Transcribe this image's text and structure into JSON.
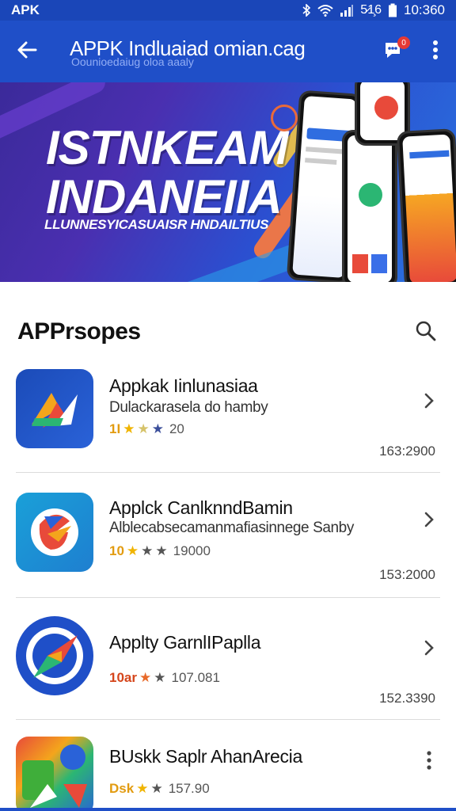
{
  "status_bar": {
    "carrier": "APK",
    "signal_text": "5̷1̧6",
    "time": "10:360"
  },
  "app_bar": {
    "title": "APPK Indluaiad omian.cag",
    "subtitle": "Oounioedaiug oloa aaaly",
    "back_icon": "arrow-left-icon",
    "chat_icon": "chat-icon",
    "chat_badge": "0",
    "more_icon": "more-vert-icon"
  },
  "banner": {
    "headline_line1": "ISTNKEAM",
    "headline_line2": "INDANEIIA",
    "tagline": "LLUNNESYICASUAISR HNDAILTIUS"
  },
  "section": {
    "title": "APPrsopes",
    "search_icon": "search-icon"
  },
  "apps": [
    {
      "name": "Appkak Iinlunasiaa",
      "description": "Dulackarasela do hamby",
      "rating_score": "1I",
      "rating_count": "20",
      "size": "163:2900",
      "action_icon": "chevron-right-icon"
    },
    {
      "name": "Applck CanlknndBamin",
      "description": "Alblecabsecamanmafiasinnege Sanby",
      "rating_score": "10",
      "rating_count": "19000",
      "size": "153:2000",
      "action_icon": "chevron-right-icon"
    },
    {
      "name": "Applty GarnlIPaplla",
      "description": "",
      "rating_score": "10ar",
      "rating_count": "107.081",
      "size": "152.3390",
      "action_icon": "chevron-right-icon"
    },
    {
      "name": "BUskk Saplr AhanArecia",
      "description": "",
      "rating_score": "Dsk",
      "rating_count": "157.90",
      "size": "",
      "action_icon": "more-vert-icon"
    }
  ],
  "colors": {
    "primary": "#1f4fc8",
    "status_bar": "#1a46b8",
    "star": "#f0b400"
  }
}
